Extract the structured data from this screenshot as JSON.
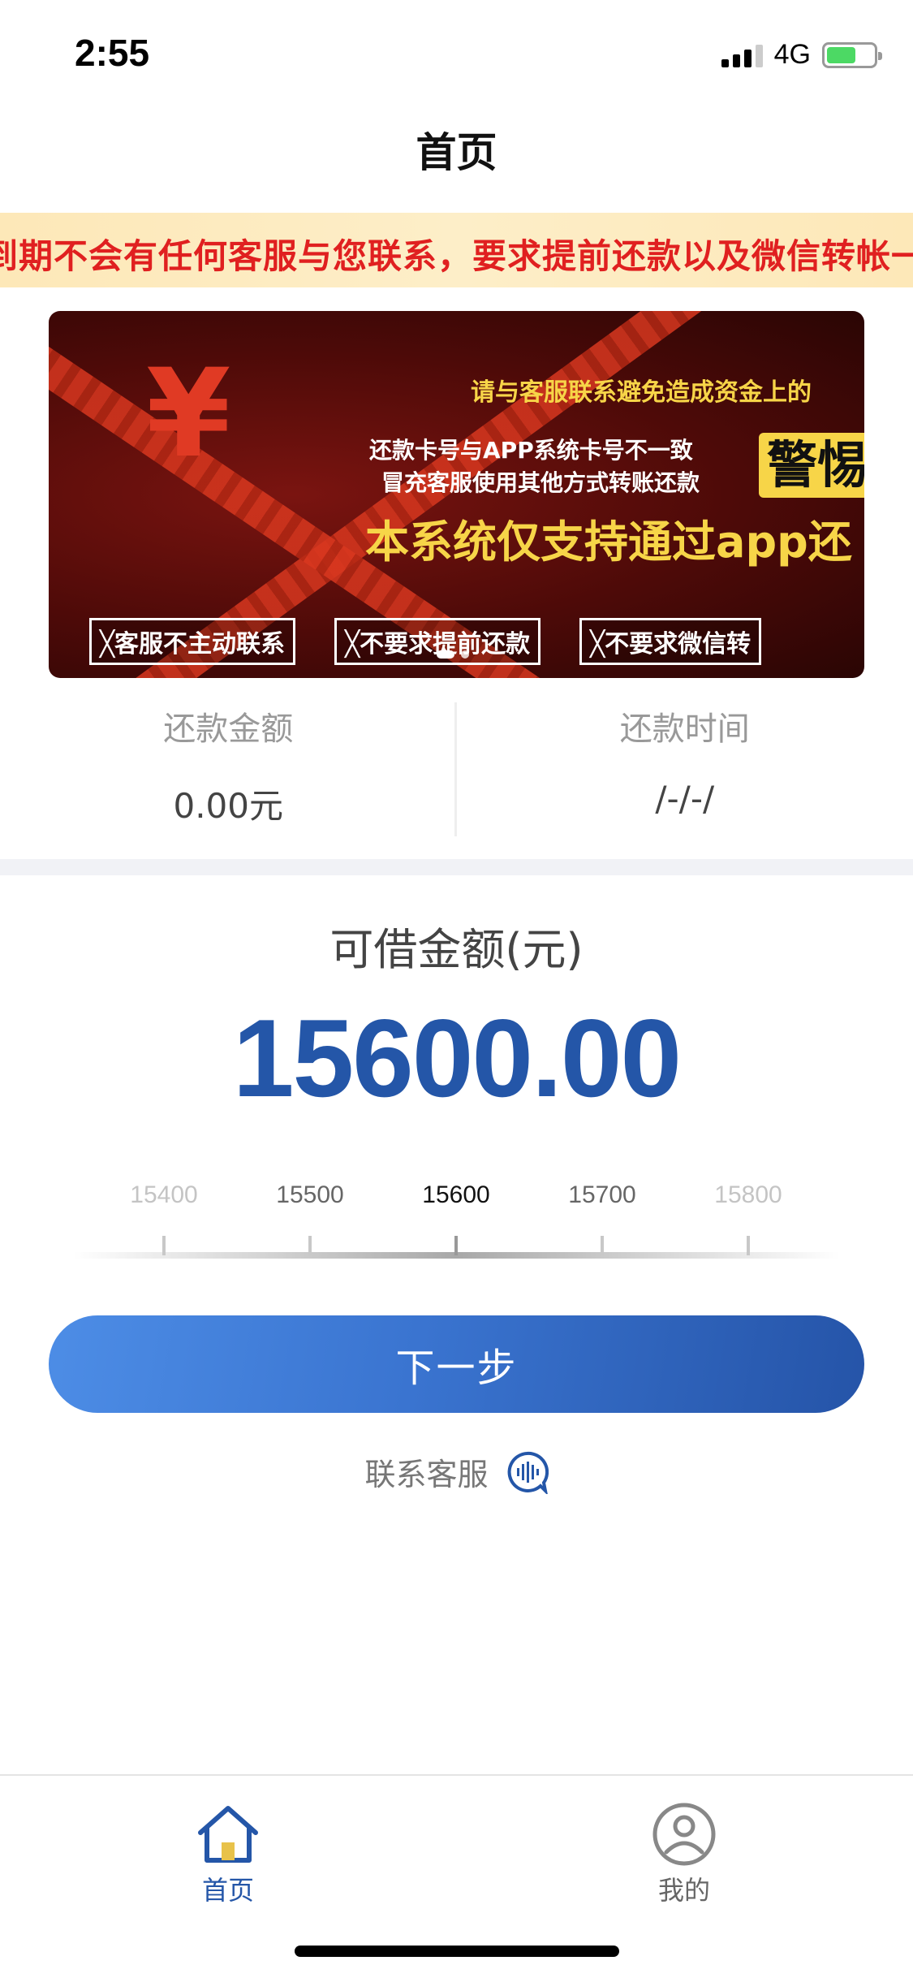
{
  "status_bar": {
    "time": "2:55",
    "network": "4G"
  },
  "header": {
    "title": "首页"
  },
  "notice": {
    "text": "到期不会有任何客服与您联系，要求提前还款以及微信转帐一"
  },
  "banner": {
    "line1": "请与客服联系避免造成资金上的",
    "line2": "还款卡号与APP系统卡号不一致",
    "line3": "冒充客服使用其他方式转账还款",
    "warning": "警惕",
    "main": "本系统仅支持通过app还",
    "tags": [
      "╳客服不主动联系",
      "╳不要求提前还款",
      "╳不要求微信转"
    ],
    "yen": "¥"
  },
  "repay": {
    "amount_label": "还款金额",
    "amount_value": "0.00元",
    "time_label": "还款时间",
    "time_value": "/-/-/"
  },
  "borrow": {
    "label": "可借金额(元)",
    "amount": "15600.00",
    "ruler_labels": [
      "15400",
      "15500",
      "15600",
      "15700",
      "15800"
    ],
    "selected_index": 2
  },
  "actions": {
    "next_label": "下一步",
    "contact_label": "联系客服"
  },
  "tabbar": {
    "home_label": "首页",
    "mine_label": "我的"
  },
  "colors": {
    "primary": "#2456a8",
    "notice_text": "#e02020",
    "notice_bg": "#fde8b8"
  }
}
